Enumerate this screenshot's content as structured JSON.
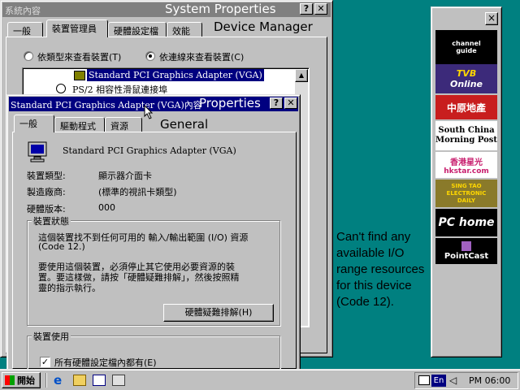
{
  "system_properties": {
    "title_left": "系統內容",
    "title_right": "System Properties",
    "tabs": [
      "一般",
      "裝置管理員",
      "硬體設定檔",
      "效能"
    ],
    "overlay_label": "Device Manager",
    "radio_by_type": "依類型來查看裝置(T)",
    "radio_by_connection": "依連線來查看裝置(C)",
    "tree_selected": "Standard PCI Graphics Adapter (VGA)",
    "tree_item2": "PS/2 相容性滑鼠連接埠"
  },
  "properties_dialog": {
    "title_left": "Standard PCI Graphics Adapter (VGA)內容",
    "title_right": "Properties",
    "tabs": [
      "一般",
      "驅動程式",
      "資源"
    ],
    "overlay_label": "General",
    "device_name": "Standard PCI Graphics Adapter (VGA)",
    "fields": [
      {
        "label": "裝置類型:",
        "value": "顯示器介面卡"
      },
      {
        "label": "製造廠商:",
        "value": "(標準的視訊卡類型)"
      },
      {
        "label": "硬體版本:",
        "value": "000"
      }
    ],
    "status_group_label": "裝置狀態",
    "status_line1": "這個裝置找不到任何可用的 輸入/輸出範圍 (I/O) 資源",
    "status_line2": "(Code 12.)",
    "status_para1": "要使用這個裝置，必須停止其它使用必要資源的裝",
    "status_para2": "置。要這樣做，請按「硬體疑難排解」，然後按照精",
    "status_para3": "靈的指示執行。",
    "troubleshoot_button": "硬體疑難排解(H)",
    "usage_group_label": "裝置使用",
    "usage_checkbox_label": "所有硬體設定檔內都有(E)",
    "usage_checked": true
  },
  "annotation": {
    "lines": [
      "Can't find any",
      "available I/O",
      "range resources",
      "for this device",
      "(Code 12)."
    ]
  },
  "channel_bar": {
    "close": "×",
    "items": [
      {
        "line1": "channel",
        "line2": "guide"
      },
      {
        "line1": "TVB",
        "line2": "Online"
      },
      {
        "line1": "中原地產",
        "line2": ""
      },
      {
        "line1": "South China",
        "line2": "Morning Post"
      },
      {
        "line1": "香港星光",
        "line2": "hkstar.com"
      },
      {
        "line1": "SING TAO",
        "line2": "ELECTRONIC DAILY"
      },
      {
        "line1": "PC home",
        "line2": ""
      },
      {
        "line1": "PointCast",
        "line2": ""
      }
    ]
  },
  "taskbar": {
    "start_label": "開始",
    "tray_lang": "En",
    "clock": "PM 06:00"
  },
  "colors": {
    "desktop": "#008080",
    "active_title": "#000080",
    "inactive_title": "#808080",
    "face": "#c0c0c0"
  }
}
